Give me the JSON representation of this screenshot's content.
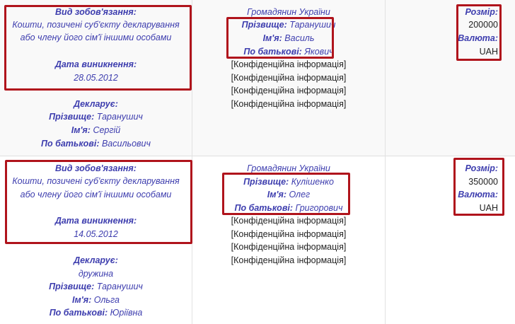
{
  "rows": [
    {
      "obligation": {
        "type_label": "Вид зобов'язання:",
        "type_lines": [
          "Кошти, позичені суб'єкту декларування",
          "або члену його сім'ї іншими особами"
        ],
        "date_label": "Дата виникнення:",
        "date": "28.05.2012",
        "declares_label": "Декларує:",
        "declares_relation": "",
        "surname_label": "Прізвище:",
        "surname": "Таранушич",
        "name_label": "Ім'я:",
        "name": "Сергій",
        "patronymic_label": "По батькові:",
        "patronymic": "Васильович"
      },
      "creditor": {
        "citizenship": "Громадянин України",
        "surname_label": "Прізвище:",
        "surname": "Таранушич",
        "name_label": "Ім'я:",
        "name": "Василь",
        "patronymic_label": "По батькові:",
        "patronymic": "Якович",
        "confidential": [
          "[Конфіденційна інформація]",
          "[Конфіденційна інформація]",
          "[Конфіденційна інформація]",
          "[Конфіденційна інформація]"
        ]
      },
      "amount": {
        "size_label": "Розмір:",
        "size": "200000",
        "currency_label": "Валюта:",
        "currency": "UAH"
      }
    },
    {
      "obligation": {
        "type_label": "Вид зобов'язання:",
        "type_lines": [
          "Кошти, позичені суб'єкту декларування",
          "або члену його сім'ї іншими особами"
        ],
        "date_label": "Дата виникнення:",
        "date": "14.05.2012",
        "declares_label": "Декларує:",
        "declares_relation": "дружина",
        "surname_label": "Прізвище:",
        "surname": "Таранушич",
        "name_label": "Ім'я:",
        "name": "Ольга",
        "patronymic_label": "По батькові:",
        "patronymic": "Юріївна"
      },
      "creditor": {
        "citizenship": "Громадянин України",
        "surname_label": "Прізвище:",
        "surname": "Кулішенко",
        "name_label": "Ім'я:",
        "name": "Олег",
        "patronymic_label": "По батькові:",
        "patronymic": "Григорович",
        "confidential": [
          "[Конфіденційна інформація]",
          "[Конфіденційна інформація]",
          "[Конфіденційна інформація]",
          "[Конфіденційна інформація]"
        ]
      },
      "amount": {
        "size_label": "Розмір:",
        "size": "350000",
        "currency_label": "Валюта:",
        "currency": "UAH"
      }
    }
  ],
  "highlight_color": "#b0141c",
  "label_color": "#3d3dae"
}
